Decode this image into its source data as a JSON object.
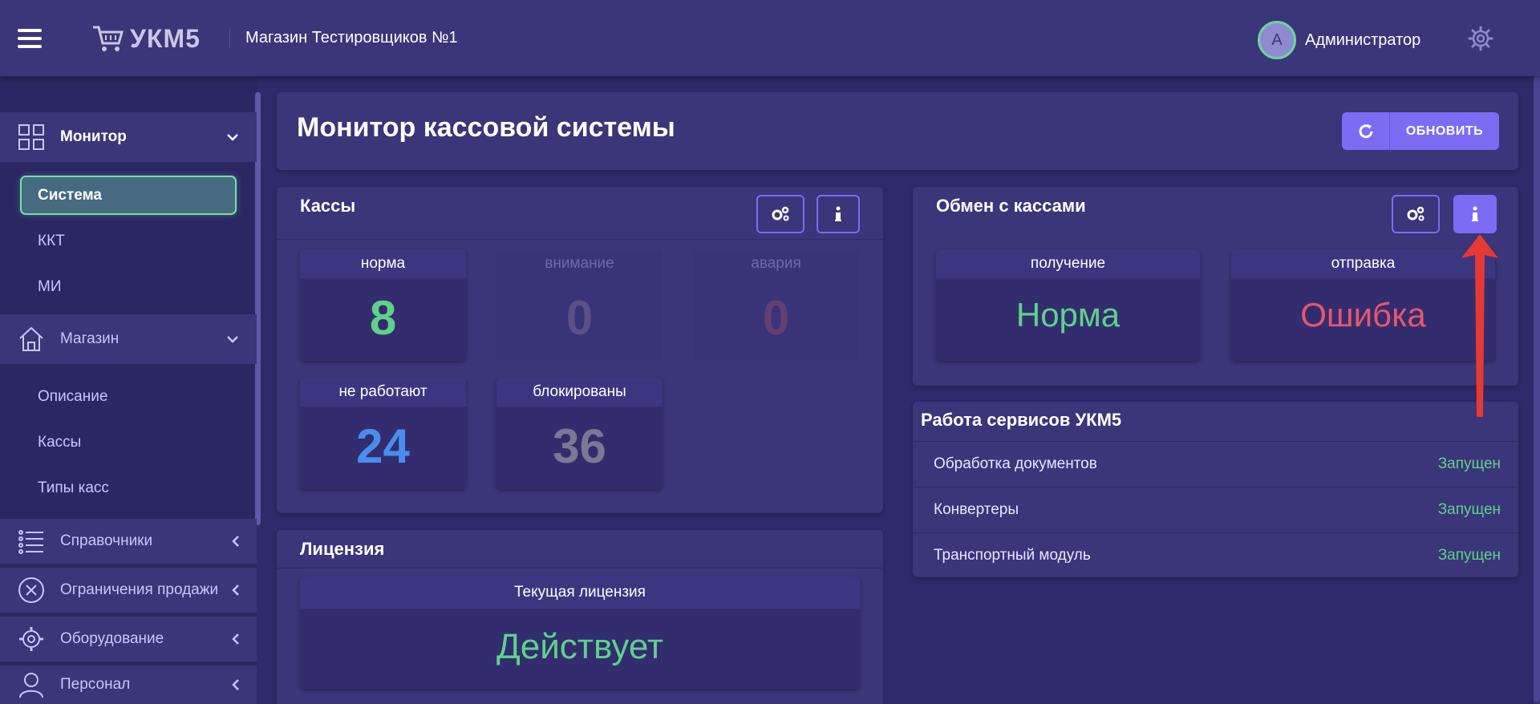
{
  "header": {
    "logo_text": "УКМ5",
    "store_name": "Магазин Тестировщиков №1",
    "avatar_letter": "A",
    "username": "Администратор",
    "icons": [
      "menu-icon",
      "cart-icon",
      "gear-icon"
    ]
  },
  "sidebar": {
    "monitor": {
      "label": "Монитор",
      "items": [
        {
          "label": "Система",
          "active": true
        },
        {
          "label": "ККТ"
        },
        {
          "label": "МИ"
        }
      ]
    },
    "store": {
      "label": "Магазин",
      "items": [
        {
          "label": "Описание"
        },
        {
          "label": "Кассы"
        },
        {
          "label": "Типы касс"
        }
      ]
    },
    "collapsed": [
      {
        "label": "Справочники",
        "icon": "list-icon"
      },
      {
        "label": "Ограничения продажи",
        "icon": "close-circle-icon"
      },
      {
        "label": "Оборудование",
        "icon": "gear-icon"
      },
      {
        "label": "Персонал",
        "icon": "user-icon"
      }
    ]
  },
  "page": {
    "title": "Монитор кассовой системы",
    "refresh_label": "ОБНОВИТЬ"
  },
  "kassy": {
    "title": "Кассы",
    "tiles": [
      {
        "label": "норма",
        "value": "8",
        "color": "#5fd18a"
      },
      {
        "label": "внимание",
        "value": "0",
        "color": "#5d4f87"
      },
      {
        "label": "авария",
        "value": "0",
        "color": "#64406f"
      },
      {
        "label": "не работают",
        "value": "24",
        "color": "#4a8df0"
      },
      {
        "label": "блокированы",
        "value": "36",
        "color": "#7a7894"
      }
    ]
  },
  "exchange": {
    "title": "Обмен с кассами",
    "tiles": [
      {
        "label": "получение",
        "value": "Норма",
        "color": "#5fd18a"
      },
      {
        "label": "отправка",
        "value": "Ошибка",
        "color": "#e8566e"
      }
    ]
  },
  "services": {
    "title": "Работа сервисов УКМ5",
    "rows": [
      {
        "name": "Обработка документов",
        "status": "Запущен"
      },
      {
        "name": "Конвертеры",
        "status": "Запущен"
      },
      {
        "name": "Транспортный модуль",
        "status": "Запущен"
      }
    ]
  },
  "license": {
    "title": "Лицензия",
    "label": "Текущая лицензия",
    "value": "Действует"
  },
  "colors": {
    "accent": "#7c6cf4",
    "ok": "#5fd18a",
    "error": "#e8566e",
    "annotation_arrow": "#e53935"
  }
}
